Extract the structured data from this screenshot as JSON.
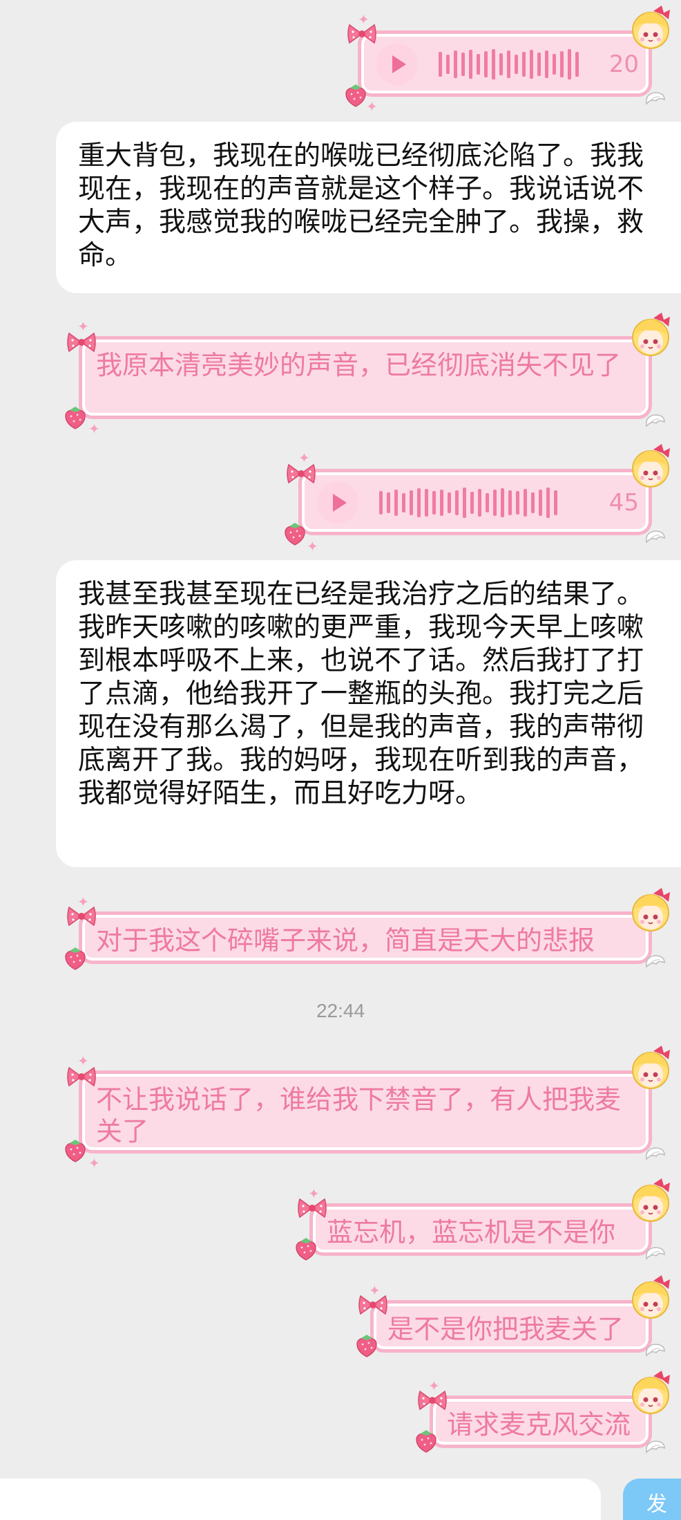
{
  "messages": [
    {
      "type": "voice",
      "duration": "20"
    },
    {
      "type": "white",
      "text": "重大背包，我现在的喉咙已经彻底沦陷了。我我现在，我现在的声音就是这个样子。我说话说不大声，我感觉我的喉咙已经完全肿了。我操，救命。"
    },
    {
      "type": "pink",
      "text": "我原本清亮美妙的声音，已经彻底消失不见了"
    },
    {
      "type": "voice",
      "duration": "45"
    },
    {
      "type": "white",
      "text": "我甚至我甚至现在已经是我治疗之后的结果了。我昨天咳嗽的咳嗽的更严重，我现今天早上咳嗽到根本呼吸不上来，也说不了话。然后我打了打了点滴，他给我开了一整瓶的头孢。我打完之后现在没有那么渴了，但是我的声音，我的声带彻底离开了我。我的妈呀，我现在听到我的声音，我都觉得好陌生，而且好吃力呀。"
    },
    {
      "type": "pink",
      "text": "对于我这个碎嘴子来说，简直是天大的悲报"
    },
    {
      "type": "pink",
      "text": "不让我说话了，谁给我下禁音了，有人把我麦关了"
    },
    {
      "type": "pink",
      "text": "蓝忘机，蓝忘机是不是你"
    },
    {
      "type": "pink",
      "text": "是不是你把我麦关了"
    },
    {
      "type": "pink",
      "text": "请求麦克风交流"
    }
  ],
  "timestamp": "22:44",
  "send_button_label": "发",
  "colors": {
    "pink_text": "#ee7aa1",
    "pink_fill": "#fcdbe6",
    "pink_border": "#f7b3c9",
    "send_blue": "#7cc8f6"
  },
  "icons": [
    "play-icon",
    "bow-icon",
    "strawberry-icon",
    "doll-avatar-icon",
    "wing-icon",
    "sparkle-icon"
  ]
}
